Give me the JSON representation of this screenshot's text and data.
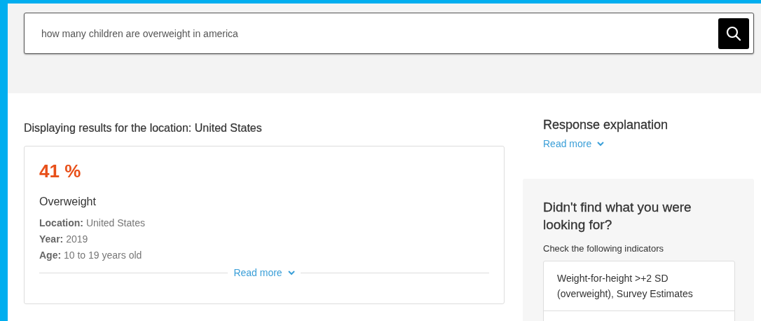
{
  "search": {
    "value": "how many children are overweight in america"
  },
  "location_heading": "Displaying results for the location: United States",
  "result": {
    "value": "41 %",
    "title": "Overweight",
    "details": [
      {
        "label": "Location:",
        "value": "United States"
      },
      {
        "label": "Year:",
        "value": "2019"
      },
      {
        "label": "Age:",
        "value": "10 to 19 years old"
      }
    ],
    "read_more": "Read more"
  },
  "explanation": {
    "title": "Response explanation",
    "read_more": "Read more"
  },
  "suggestions": {
    "title": "Didn't find what you were looking for?",
    "subtitle": "Check the following indicators",
    "indicators": [
      "Weight-for-height >+2 SD (overweight), Survey Estimates"
    ]
  }
}
